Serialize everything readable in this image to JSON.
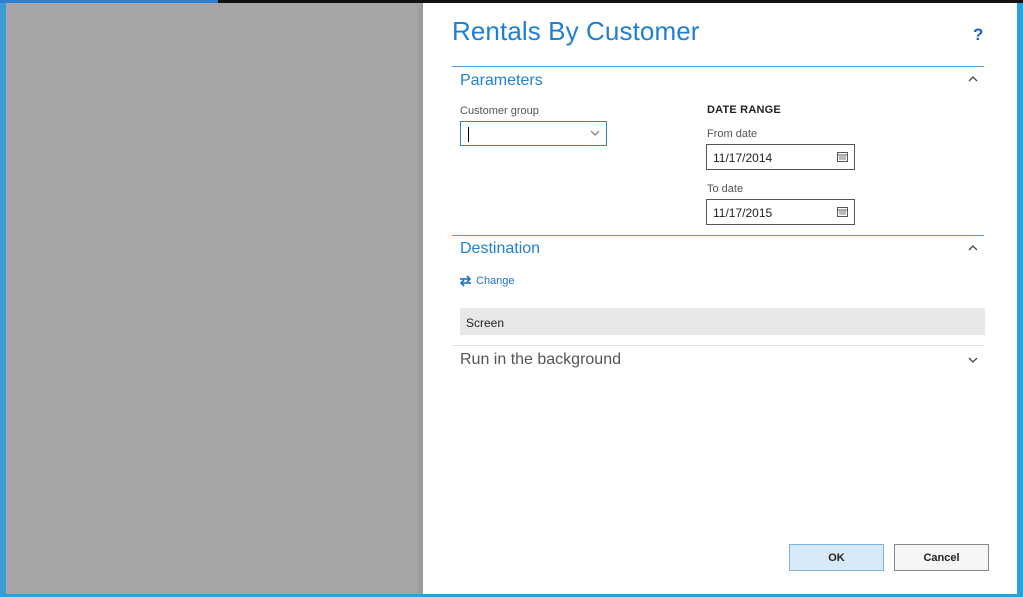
{
  "dialog": {
    "title": "Rentals By Customer",
    "help_label": "?"
  },
  "parameters": {
    "title": "Parameters",
    "customer_group": {
      "label": "Customer group",
      "value": ""
    },
    "date_range": {
      "heading": "DATE RANGE",
      "from_label": "From date",
      "from_value": "11/17/2014",
      "to_label": "To date",
      "to_value": "11/17/2015"
    }
  },
  "destination": {
    "title": "Destination",
    "change_label": "Change",
    "selected": "Screen"
  },
  "background": {
    "title": "Run in the background"
  },
  "buttons": {
    "ok": "OK",
    "cancel": "Cancel"
  },
  "colors": {
    "accent": "#1f7fd1",
    "frame": "#29a1dc",
    "overlay": "#a6a6a6"
  }
}
